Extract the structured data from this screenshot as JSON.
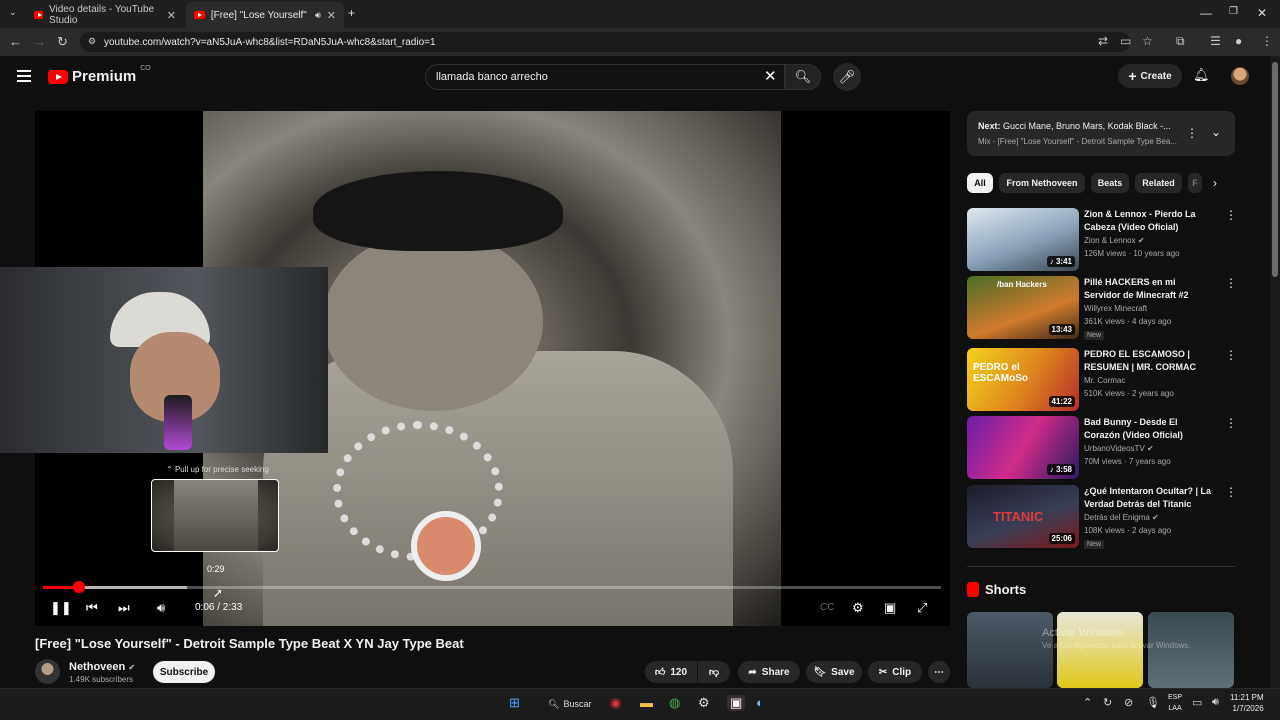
{
  "browser": {
    "tabs": [
      {
        "label": "Video details - YouTube Studio"
      },
      {
        "label": "[Free] \"Lose Yourself\" - Detr",
        "audio_icon": "speaker-icon"
      }
    ],
    "new_tab": "+",
    "url": "youtube.com/watch?v=aN5JuA-whc8&list=RDaN5JuA-whc8&start_radio=1"
  },
  "masthead": {
    "logo": "Premium",
    "region": "CO",
    "search_value": "llamada banco arrecho",
    "create_label": "Create"
  },
  "player": {
    "seek_hint": "Pull up for precise seeking",
    "preview_time": "0:29",
    "current_time": "0:06",
    "duration": "2:33",
    "time_display": "0:06 / 2:33",
    "progress_played": 0.04,
    "progress_buffered": 0.16
  },
  "video": {
    "title": "[Free] \"Lose Yourself\" - Detroit Sample Type Beat X YN Jay Type Beat",
    "channel": "Nethoveen",
    "subscribers": "1.49K subscribers",
    "subscribe_label": "Subscribe",
    "likes": "120",
    "share_label": "Share",
    "save_label": "Save",
    "clip_label": "Clip"
  },
  "sidebar": {
    "next_label": "Next:",
    "next_title": "Gucci Mane, Bruno Mars, Kodak Black -...",
    "next_mix": "Mix - [Free] \"Lose Yourself\" - Detroit Sample Type Bea...",
    "chips": [
      "All",
      "From Nethoveen",
      "Beats",
      "Related",
      "F"
    ],
    "recommendations": [
      {
        "title": "Zion & Lennox - Pierdo La Cabeza (Video Oficial)",
        "channel": "Zion & Lennox",
        "meta": "126M views · 10 years ago",
        "duration": "3:41",
        "new": ""
      },
      {
        "title": "Pillé HACKERS en mi Servidor de Minecraft #2",
        "channel": "Willyrex Minecraft",
        "meta": "361K views · 4 days ago",
        "duration": "13:43",
        "new": "New",
        "thumb_text": "/ban Hackers"
      },
      {
        "title": "PEDRO EL ESCAMOSO | RESUMEN | MR. CORMAC",
        "channel": "Mr. Cormac",
        "meta": "510K views · 2 years ago",
        "duration": "41:22",
        "new": "",
        "thumb_text": "PEDRO el ESCAMoSo"
      },
      {
        "title": "Bad Bunny - Desde El Corazón (Video Oficial)",
        "channel": "UrbanoVideosTV",
        "meta": "70M views · 7 years ago",
        "duration": "3:58",
        "new": ""
      },
      {
        "title": "¿Qué Intentaron Ocultar? | La Verdad Detrás del Titanic",
        "channel": "Detrás del Enigma",
        "meta": "108K views · 2 days ago",
        "duration": "25:06",
        "new": "New",
        "thumb_text": "TITANIC"
      }
    ],
    "shorts_label": "Shorts",
    "watermark_line1": "Activar Windows",
    "watermark_line2": "Ve a Configuración para activar Windows."
  },
  "taskbar": {
    "search_label": "Buscar",
    "lang_1": "ESP",
    "lang_2": "LAA",
    "time": "11:21 PM",
    "date": "1/7/2026"
  }
}
